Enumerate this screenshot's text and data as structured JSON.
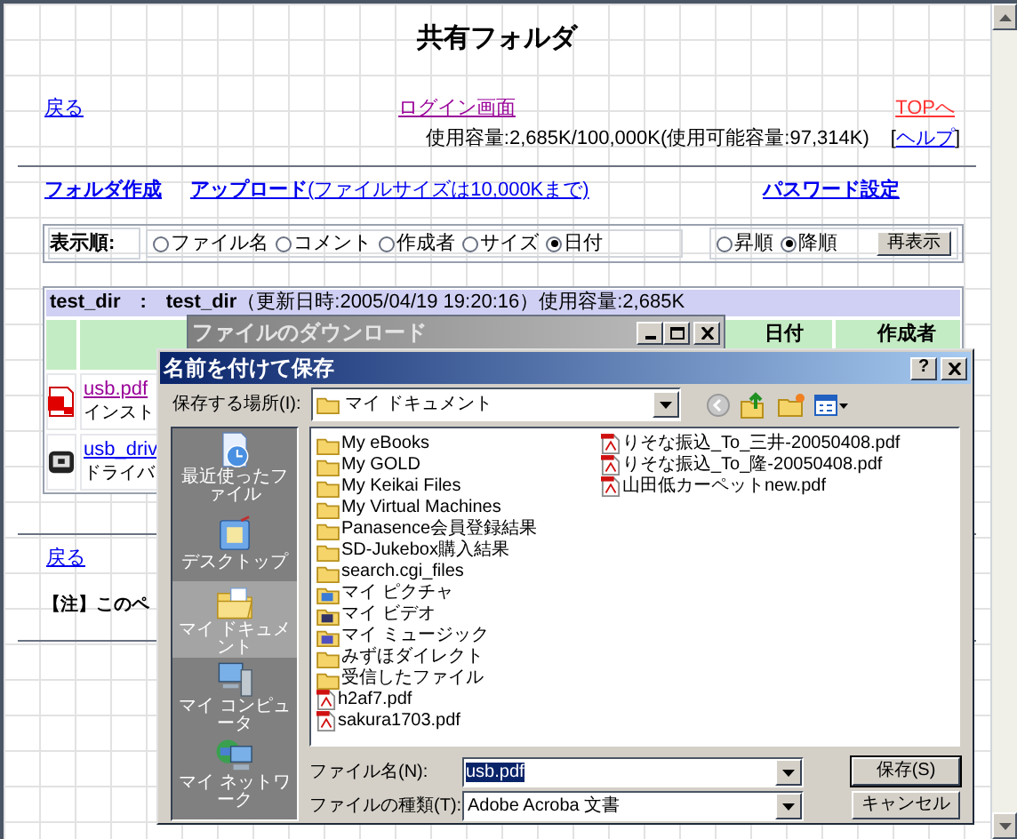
{
  "page": {
    "title": "共有フォルダ",
    "back_link": "戻る",
    "login_link": "ログイン画面",
    "top_link": "TOPへ",
    "usage": "使用容量:2,685K/100,000K(使用可能容量:97,314K)",
    "help_open": "[",
    "help_link": "ヘルプ",
    "help_close": "]"
  },
  "actions": {
    "create_folder": "フォルダ作成",
    "upload": "**アップロード**(ファイルサイズは10,000Kまで)",
    "password": "パスワード設定"
  },
  "sort": {
    "label": "表示順:",
    "fields": [
      {
        "label": "ファイル名",
        "selected": false
      },
      {
        "label": "コメント",
        "selected": false
      },
      {
        "label": "作成者",
        "selected": false
      },
      {
        "label": "サイズ",
        "selected": false
      },
      {
        "label": "日付",
        "selected": true
      }
    ],
    "order": [
      {
        "label": "昇順",
        "selected": false
      },
      {
        "label": "降順",
        "selected": true
      }
    ],
    "button": "再表示"
  },
  "folder_table": {
    "header": "**test_dir　:　test_dir**（更新日時:2005/04/19 19:20:16）使用容量:2,685K",
    "columns": [
      "日付",
      "作成者"
    ],
    "rows": [
      {
        "kind": "pdf",
        "name": "usb.pdf",
        "comment": "インスト",
        "visited": true
      },
      {
        "kind": "driver",
        "name": "usb_driv",
        "comment": "ドライバ",
        "visited": false
      }
    ]
  },
  "footer": {
    "back_link": "戻る",
    "note": "【注】このペ"
  },
  "download_dialog": {
    "title": "ファイルのダウンロード"
  },
  "save_dialog": {
    "title": "名前を付けて保存",
    "help": "?",
    "location_label": "保存する場所(I):",
    "location": "マイ ドキュメント",
    "places": [
      {
        "label": "最近使ったファイル",
        "kind": "recent",
        "selected": false
      },
      {
        "label": "デスクトップ",
        "kind": "desktop",
        "selected": false
      },
      {
        "label": "マイ ドキュメント",
        "kind": "documents",
        "selected": true
      },
      {
        "label": "マイ コンピュータ",
        "kind": "computer",
        "selected": false
      },
      {
        "label": "マイ ネットワーク",
        "kind": "network",
        "selected": false
      }
    ],
    "files": [
      {
        "name": "My eBooks",
        "kind": "folder"
      },
      {
        "name": "My GOLD",
        "kind": "folder"
      },
      {
        "name": "My Keikai Files",
        "kind": "folder"
      },
      {
        "name": "My Virtual Machines",
        "kind": "folder"
      },
      {
        "name": "Panasence会員登録結果",
        "kind": "folder"
      },
      {
        "name": "SD-Jukebox購入結果",
        "kind": "folder"
      },
      {
        "name": "search.cgi_files",
        "kind": "folder"
      },
      {
        "name": "マイ ピクチャ",
        "kind": "pictures"
      },
      {
        "name": "マイ ビデオ",
        "kind": "videos"
      },
      {
        "name": "マイ ミュージック",
        "kind": "music"
      },
      {
        "name": "みずほダイレクト",
        "kind": "folder"
      },
      {
        "name": "受信したファイル",
        "kind": "folder"
      },
      {
        "name": "h2af7.pdf",
        "kind": "pdf"
      },
      {
        "name": "sakura1703.pdf",
        "kind": "pdf"
      },
      {
        "name": "りそな振込_To_三井-20050408.pdf",
        "kind": "pdf"
      },
      {
        "name": "りそな振込_To_隆-20050408.pdf",
        "kind": "pdf"
      },
      {
        "name": "山田低カーペットnew.pdf",
        "kind": "pdf"
      }
    ],
    "filename_label": "ファイル名(N):",
    "filename": "usb.pdf",
    "type_label": "ファイルの種類(T):",
    "type": "Adobe Acroba 文書",
    "buttons": [
      "保存(S)",
      "キャンセル"
    ]
  }
}
